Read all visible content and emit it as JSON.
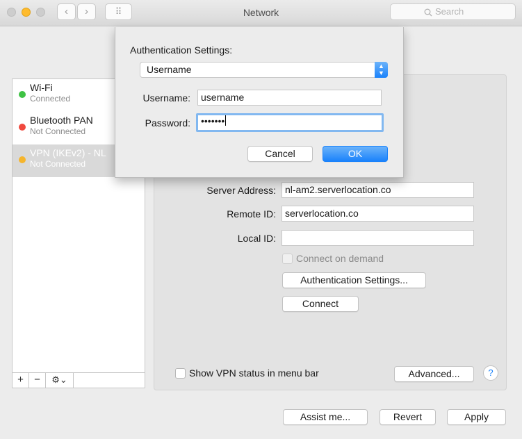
{
  "window": {
    "title": "Network",
    "search_placeholder": "Search",
    "traffic_colors": [
      "#cdcdcd",
      "#febb2e",
      "#cdcdcd"
    ]
  },
  "toolbar": {
    "back_glyph": "‹",
    "forward_glyph": "›",
    "grid_glyph": "⠿"
  },
  "sidebar": {
    "items": [
      {
        "name": "Wi-Fi",
        "status": "Connected",
        "dot_color": "#3ec244"
      },
      {
        "name": "Bluetooth PAN",
        "status": "Not Connected",
        "dot_color": "#f0493e"
      },
      {
        "name": "VPN (IKEv2) - NL",
        "status": "Not Connected",
        "dot_color": "#f5b52d"
      }
    ],
    "add_label": "+",
    "remove_label": "−",
    "gear_label": "⚙⌄"
  },
  "detail": {
    "server_address_label": "Server Address:",
    "server_address_value": "nl-am2.serverlocation.co",
    "remote_id_label": "Remote ID:",
    "remote_id_value": "serverlocation.co",
    "local_id_label": "Local ID:",
    "local_id_value": "",
    "connect_on_demand_label": "Connect on demand",
    "auth_settings_button": "Authentication Settings...",
    "connect_button": "Connect",
    "show_vpn_status_label": "Show VPN status in menu bar",
    "advanced_button": "Advanced...",
    "help_glyph": "?"
  },
  "footer": {
    "assist_button": "Assist me...",
    "revert_button": "Revert",
    "apply_button": "Apply"
  },
  "sheet": {
    "title": "Authentication Settings:",
    "method_selected": "Username",
    "username_label": "Username:",
    "username_value": "username",
    "password_label": "Password:",
    "password_value": "•••••••",
    "cancel_button": "Cancel",
    "ok_button": "OK"
  },
  "colors": {
    "accent": "#1a82fb",
    "focus_ring": "#82b8f0"
  }
}
